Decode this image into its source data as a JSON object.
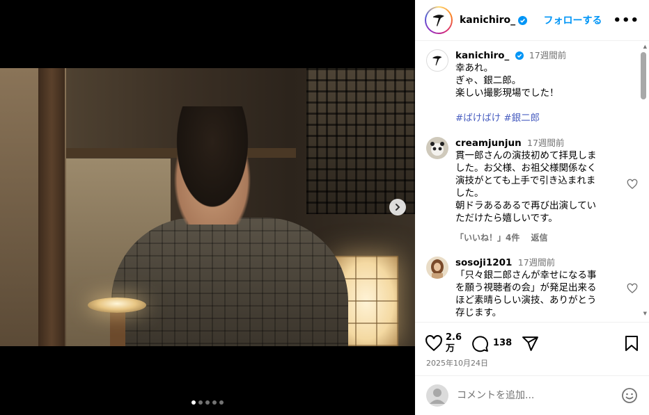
{
  "post": {
    "username": "kanichiro_",
    "follow_label": "フォローする",
    "more_label": "•••",
    "caption_time": "17週間前",
    "caption_lines": [
      "幸あれ。",
      "ぎゃ、銀二郎。",
      "楽しい撮影現場でした！"
    ],
    "hashtags": [
      "#ばけばけ",
      "#銀二郎"
    ],
    "likes_top": "2.6",
    "likes_bottom": "万",
    "comment_count": "138",
    "date": "2025年10月24日",
    "carousel": {
      "total": 5,
      "active": 1
    }
  },
  "comments": [
    {
      "user": "creamjunjun",
      "time": "17週間前",
      "lines": [
        "貫一郎さんの演技初めて拝見しま",
        "した。お父様、お祖父様関係なく",
        "演技がとても上手で引き込まれま",
        "した。",
        "朝ドラあるあるで再び出演してい",
        "ただけたら嬉しいです。"
      ],
      "likes_label": "「いいね！」4件",
      "reply_label": "返信"
    },
    {
      "user": "sosoji1201",
      "time": "17週間前",
      "lines": [
        "「只々銀二郎さんが幸せになる事",
        "を願う視聴者の会」が発足出来る",
        "ほど素晴らしい演技、ありがとう",
        "存じます。"
      ]
    }
  ],
  "add_comment": {
    "placeholder": "コメントを追加..."
  },
  "colors": {
    "accent": "#0095f6",
    "hashtag": "#4a5fc1",
    "muted": "#737373"
  },
  "icons": [
    "verified-badge-icon",
    "next-arrow-icon",
    "heart-icon",
    "comment-icon",
    "share-icon",
    "bookmark-icon",
    "emoji-icon",
    "kebab-menu-icon"
  ]
}
